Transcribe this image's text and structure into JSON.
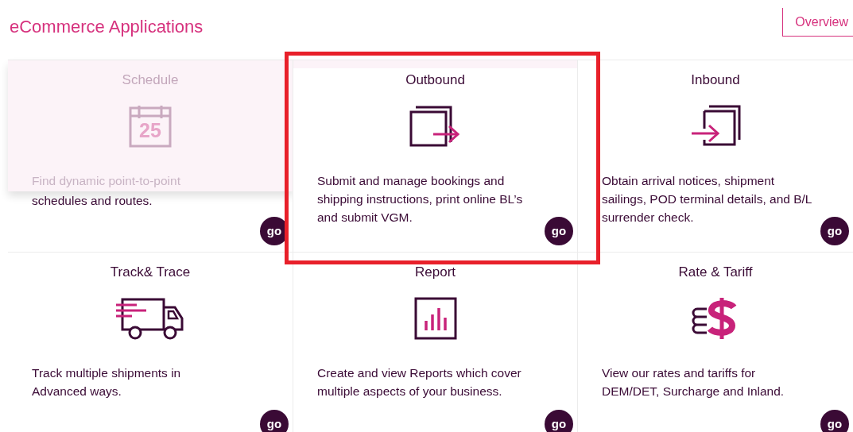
{
  "header": {
    "title": "eCommerce Applications",
    "overview_button": "Overview"
  },
  "cards": [
    {
      "title": "Schedule",
      "icon_text": "25",
      "description_lines": [
        "Find dynamic point-to-point",
        "schedules and routes."
      ],
      "dimmed": true,
      "highlighted": false,
      "go": "go"
    },
    {
      "title": "Outbound",
      "description_lines": [
        "Submit and manage bookings and",
        "shipping instructions, print online BL’s",
        "and submit VGM."
      ],
      "dimmed": false,
      "highlighted": true,
      "go": "go"
    },
    {
      "title": "Inbound",
      "description_lines": [
        "Obtain arrival notices, shipment",
        "sailings, POD terminal details, and B/L",
        "surrender check."
      ],
      "dimmed": false,
      "highlighted": false,
      "go": "go"
    },
    {
      "title": "Track& Trace",
      "description_lines": [
        "Track multiple shipments in",
        "Advanced ways."
      ],
      "dimmed": false,
      "highlighted": false,
      "go": "go"
    },
    {
      "title": "Report",
      "description_lines": [
        "Create and view Reports which cover",
        "multiple aspects of your business."
      ],
      "dimmed": false,
      "highlighted": false,
      "go": "go"
    },
    {
      "title": "Rate & Tariff",
      "description_lines": [
        "View our rates and tariffs for",
        "DEM/DET, Surcharge and Inland."
      ],
      "dimmed": false,
      "highlighted": false,
      "go": "go"
    }
  ]
}
